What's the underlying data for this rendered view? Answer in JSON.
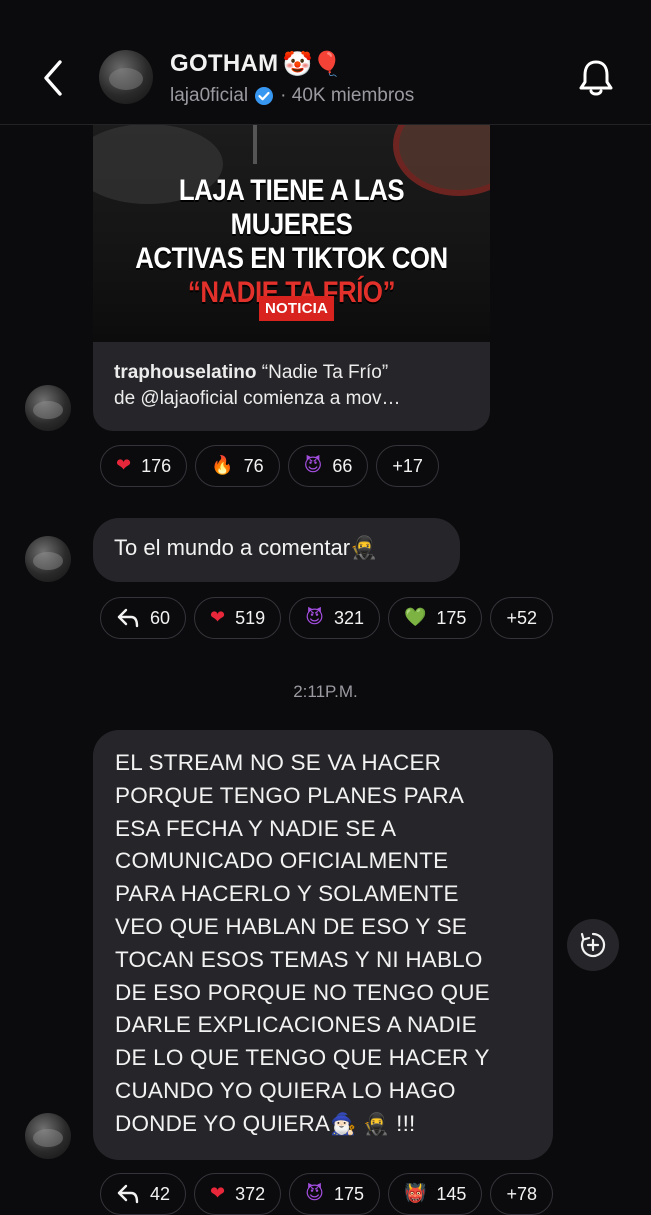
{
  "header": {
    "title": "GOTHAM",
    "title_emojis": "🤡🎈",
    "handle": "laja0ficial",
    "members": "· 40K miembros"
  },
  "shared_post": {
    "headline_line1": "LAJA TIENE A LAS MUJERES",
    "headline_line2": "ACTIVAS EN TIKTOK CON",
    "headline_quote": "“NADIE TA FRÍO”",
    "badge": "NOTICIA",
    "author": "traphouselatino",
    "caption_line1": " “Nadie Ta Frío”",
    "caption_line2": "de @lajaoficial comienza a mov…"
  },
  "shared_post_reactions": [
    {
      "emoji": "❤",
      "count": "176"
    },
    {
      "emoji": "🔥",
      "count": "76"
    },
    {
      "emoji": "😈",
      "count": "66"
    },
    {
      "emoji": "",
      "count": "+17"
    }
  ],
  "message1": {
    "text": "To el mundo a comentar",
    "emoji": "🥷"
  },
  "message1_reactions": [
    {
      "emoji": "↩",
      "count": "60"
    },
    {
      "emoji": "❤",
      "count": "519"
    },
    {
      "emoji": "😈",
      "count": "321"
    },
    {
      "emoji": "💚",
      "count": "175"
    },
    {
      "emoji": "",
      "count": "+52"
    }
  ],
  "timestamp": "2:11P.M.",
  "message2": {
    "text": "EL STREAM NO SE VA HACER\nPORQUE TENGO PLANES PARA\nESA FECHA Y NADIE SE A\nCOMUNICADO OFICIALMENTE\nPARA HACERLO Y SOLAMENTE\nVEO QUE HABLAN DE ESO Y SE\nTOCAN ESOS TEMAS Y NI HABLO\nDE ESO PORQUE NO TENGO QUE\nDARLE EXPLICACIONES A NADIE\nDE LO QUE TENGO QUE HACER Y\nCUANDO YO QUIERA LO HAGO\nDONDE YO QUIERA",
    "tail_emojis": "🧙🏻‍♂️ 🥷",
    "tail_text": " !!!"
  },
  "message2_reactions": [
    {
      "emoji": "↩",
      "count": "42"
    },
    {
      "emoji": "❤",
      "count": "372"
    },
    {
      "emoji": "😈",
      "count": "175"
    },
    {
      "emoji": "👹",
      "count": "145"
    },
    {
      "emoji": "",
      "count": "+78"
    }
  ],
  "colors": {
    "background": "#0b0b0d",
    "bubble": "#26262a",
    "pill_border": "#34343a",
    "muted_text": "#9a9aa0",
    "verified_blue": "#3897f0",
    "headline_red": "#e2302a"
  }
}
